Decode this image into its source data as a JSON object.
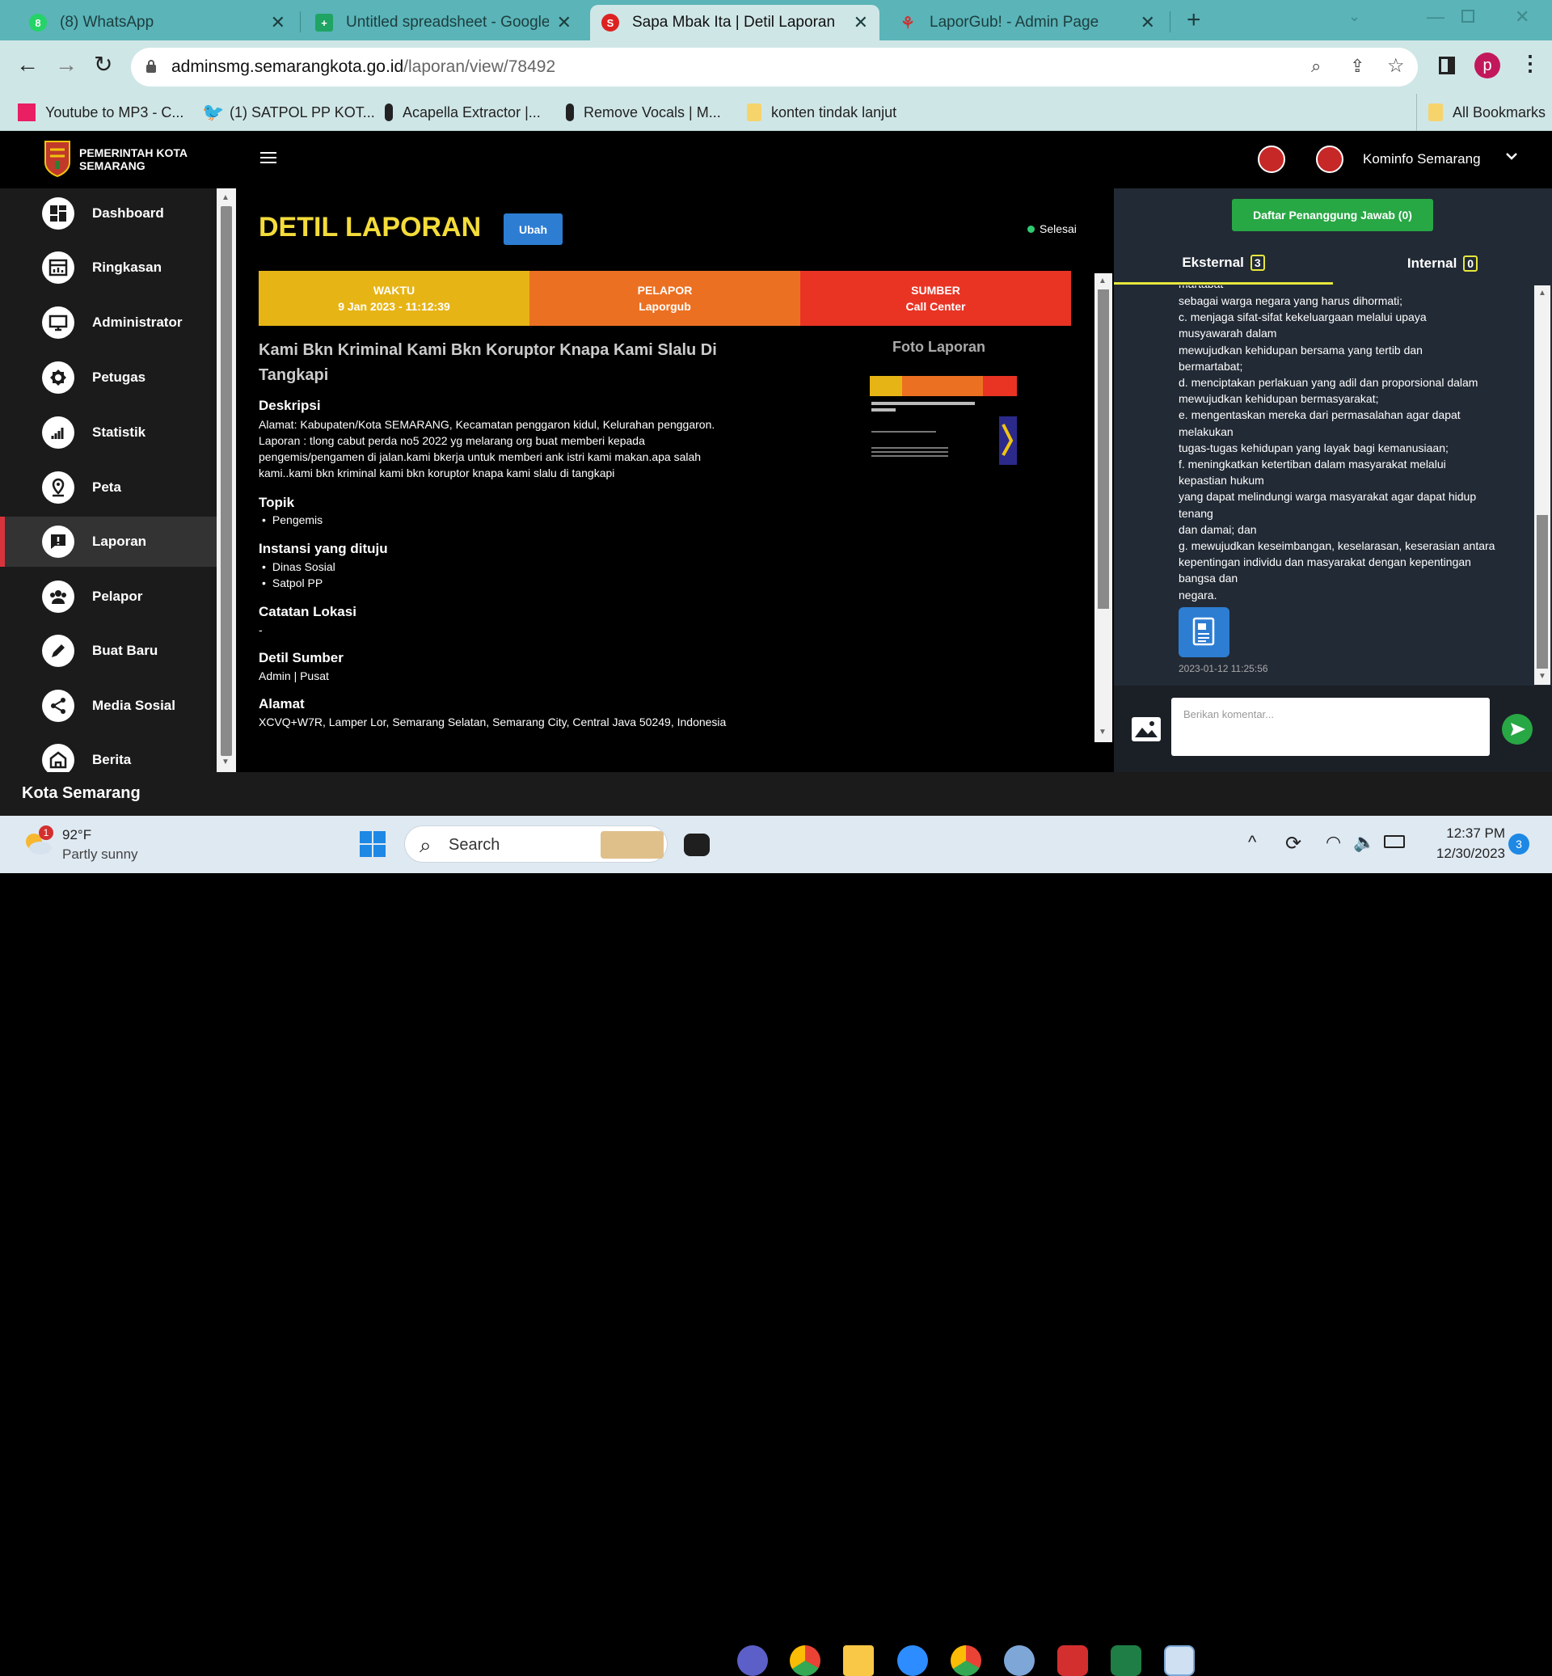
{
  "browser": {
    "tabs": [
      {
        "title": "(8) WhatsApp"
      },
      {
        "title": "Untitled spreadsheet - Google S"
      },
      {
        "title": "Sapa Mbak Ita | Detil Laporan"
      },
      {
        "title": "LaporGub! - Admin Page"
      }
    ],
    "url_host": "adminsmg.semarangkota.go.id",
    "url_path": "/laporan/view/78492",
    "profile_initial": "p",
    "bookmarks": [
      {
        "label": "Youtube to MP3 - C..."
      },
      {
        "label": "(1) SATPOL PP KOT..."
      },
      {
        "label": "Acapella Extractor |..."
      },
      {
        "label": "Remove Vocals | M..."
      },
      {
        "label": "konten tindak lanjut"
      }
    ],
    "all_bookmarks": "All Bookmarks"
  },
  "app": {
    "logo_line1": "PEMERINTAH KOTA",
    "logo_line2": "SEMARANG",
    "user_name": "Kominfo Semarang",
    "sidebar": [
      {
        "label": "Dashboard",
        "icon": "dashboard-icon"
      },
      {
        "label": "Ringkasan",
        "icon": "summary-icon"
      },
      {
        "label": "Administrator",
        "icon": "monitor-icon"
      },
      {
        "label": "Petugas",
        "icon": "badge-icon"
      },
      {
        "label": "Statistik",
        "icon": "bar-chart-icon"
      },
      {
        "label": "Peta",
        "icon": "map-pin-icon"
      },
      {
        "label": "Laporan",
        "icon": "report-icon"
      },
      {
        "label": "Pelapor",
        "icon": "users-icon"
      },
      {
        "label": "Buat Baru",
        "icon": "pencil-icon"
      },
      {
        "label": "Media Sosial",
        "icon": "share-icon"
      },
      {
        "label": "Berita",
        "icon": "news-icon"
      }
    ],
    "footer": "Kota Semarang"
  },
  "report": {
    "heading": "DETIL LAPORAN",
    "edit_button": "Ubah",
    "status": "Selesai",
    "status_color": "#2ecc71",
    "stats": [
      {
        "label": "WAKTU",
        "value": "9 Jan 2023 - 11:12:39",
        "color": "#e7b416"
      },
      {
        "label": "PELAPOR",
        "value": "Laporgub",
        "color": "#ec7021"
      },
      {
        "label": "SUMBER",
        "value": "Call Center",
        "color": "#e93424"
      }
    ],
    "title_line1": "Kami Bkn Kriminal Kami Bkn Koruptor Knapa Kami Slalu Di",
    "title_line2": "Tangkapi",
    "photo_heading": "Foto Laporan",
    "desc_heading": "Deskripsi",
    "desc_lines": [
      "Alamat: Kabupaten/Kota SEMARANG, Kecamatan penggaron kidul, Kelurahan penggaron.",
      "Laporan : tlong cabut perda no5 2022 yg melarang org buat memberi kepada",
      "pengemis/pengamen di jalan.kami bkerja untuk memberi ank istri kami makan.apa salah",
      "kami..kami bkn kriminal kami bkn koruptor knapa kami slalu di tangkapi"
    ],
    "topic_heading": "Topik",
    "topics": [
      "Pengemis"
    ],
    "agency_heading": "Instansi yang dituju",
    "agencies": [
      "Dinas Sosial",
      "Satpol PP"
    ],
    "location_note_heading": "Catatan Lokasi",
    "location_note": "-",
    "source_heading": "Detil Sumber",
    "source_detail": "Admin | Pusat",
    "address_heading": "Alamat",
    "address": "XCVQ+W7R, Lamper Lor, Semarang Selatan, Semarang City, Central Java 50249, Indonesia"
  },
  "panel": {
    "responsible_button": "Daftar Penanggung Jawab (0)",
    "tabs": [
      {
        "label": "Eksternal",
        "count": "3"
      },
      {
        "label": "Internal",
        "count": "0"
      }
    ],
    "comment_partial": "martabat",
    "comment_lines": [
      "sebagai warga negara yang harus dihormati;",
      "c. menjaga sifat-sifat kekeluargaan melalui upaya",
      "musyawarah dalam",
      "mewujudkan kehidupan bersama yang tertib dan",
      "bermartabat;",
      "d. menciptakan perlakuan yang adil dan proporsional dalam",
      "mewujudkan kehidupan bermasyarakat;",
      "e. mengentaskan mereka dari permasalahan agar dapat",
      "melakukan",
      "tugas-tugas kehidupan yang layak bagi kemanusiaan;",
      "f. meningkatkan ketertiban dalam masyarakat melalui",
      "kepastian hukum",
      "yang dapat melindungi warga masyarakat agar dapat hidup",
      "tenang",
      "dan damai; dan",
      "g. mewujudkan keseimbangan, keselarasan, keserasian antara",
      "kepentingan individu dan masyarakat dengan kepentingan",
      "bangsa dan",
      "negara."
    ],
    "comment_time": "2023-01-12 11:25:56",
    "comment_placeholder": "Berikan komentar..."
  },
  "taskbar": {
    "weather_temp": "92°F",
    "weather_desc": "Partly sunny",
    "weather_badge": "1",
    "search": "Search",
    "time": "12:37 PM",
    "date": "12/30/2023",
    "notif_count": "3"
  }
}
